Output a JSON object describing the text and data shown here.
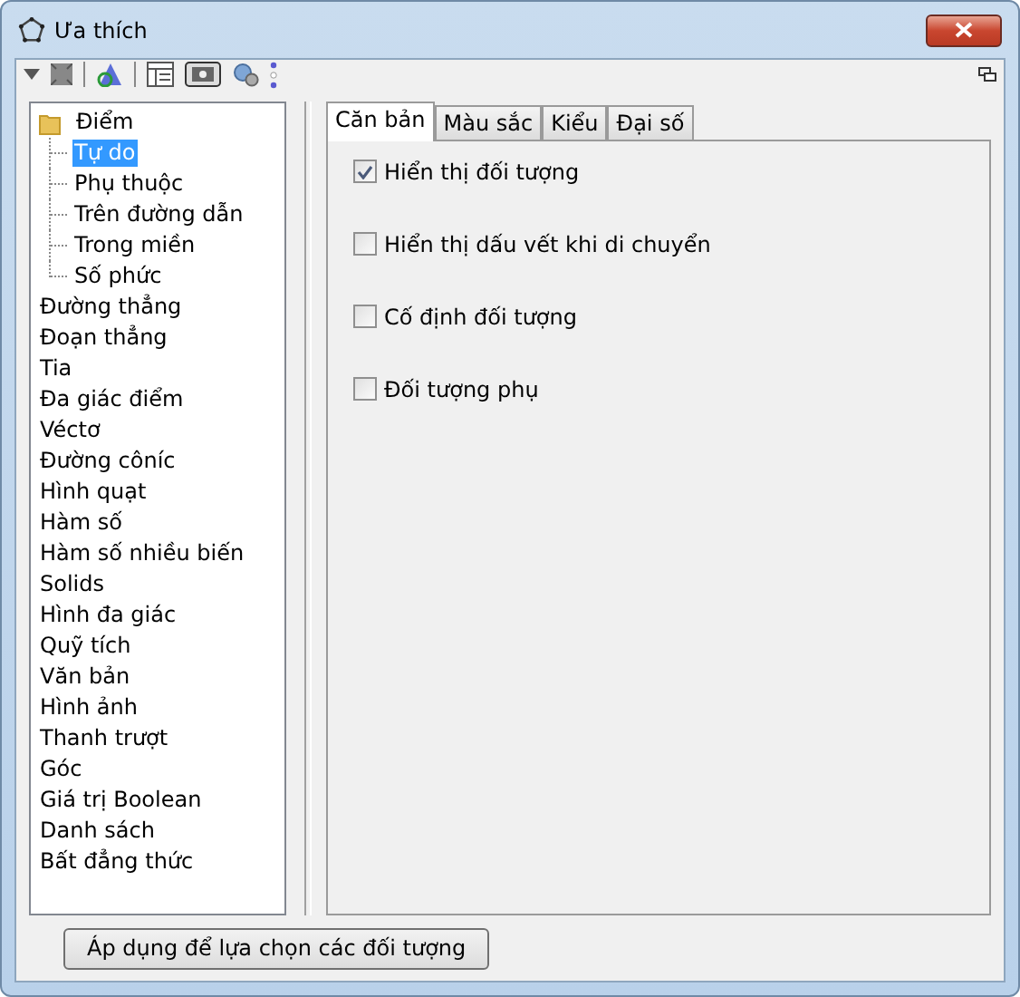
{
  "window": {
    "title": "Ưa thích"
  },
  "tree": [
    {
      "label": "Điểm",
      "selected": false,
      "children": [
        {
          "label": "Tự do",
          "selected": true
        },
        {
          "label": "Phụ thuộc",
          "selected": false
        },
        {
          "label": "Trên đường dẫn",
          "selected": false
        },
        {
          "label": "Trong miền",
          "selected": false
        },
        {
          "label": "Số phức",
          "selected": false
        }
      ]
    },
    {
      "label": "Đường thẳng",
      "selected": false
    },
    {
      "label": "Đoạn thẳng",
      "selected": false
    },
    {
      "label": "Tia",
      "selected": false
    },
    {
      "label": "Đa giác điểm",
      "selected": false
    },
    {
      "label": "Véctơ",
      "selected": false
    },
    {
      "label": "Đường côníc",
      "selected": false
    },
    {
      "label": "Hình quạt",
      "selected": false
    },
    {
      "label": "Hàm số",
      "selected": false
    },
    {
      "label": "Hàm số nhiều biến",
      "selected": false
    },
    {
      "label": "Solids",
      "selected": false
    },
    {
      "label": "Hình đa giác",
      "selected": false
    },
    {
      "label": "Quỹ tích",
      "selected": false
    },
    {
      "label": "Văn bản",
      "selected": false
    },
    {
      "label": "Hình ảnh",
      "selected": false
    },
    {
      "label": "Thanh trượt",
      "selected": false
    },
    {
      "label": "Góc",
      "selected": false
    },
    {
      "label": "Giá trị Boolean",
      "selected": false
    },
    {
      "label": "Danh sách",
      "selected": false
    },
    {
      "label": "Bất đẳng thức",
      "selected": false
    }
  ],
  "tabs": [
    {
      "label": "Căn bản",
      "selected": true
    },
    {
      "label": "Màu sắc",
      "selected": false
    },
    {
      "label": "Kiểu",
      "selected": false
    },
    {
      "label": "Đại số",
      "selected": false
    }
  ],
  "options": [
    {
      "label": "Hiển thị đối tượng",
      "checked": true
    },
    {
      "label": "Hiển thị dấu vết khi di chuyển",
      "checked": false
    },
    {
      "label": "Cố định đối tượng",
      "checked": false
    },
    {
      "label": "Đối tượng phụ",
      "checked": false
    }
  ],
  "apply_button": {
    "label": "Áp dụng để lựa chọn các đối tượng"
  }
}
